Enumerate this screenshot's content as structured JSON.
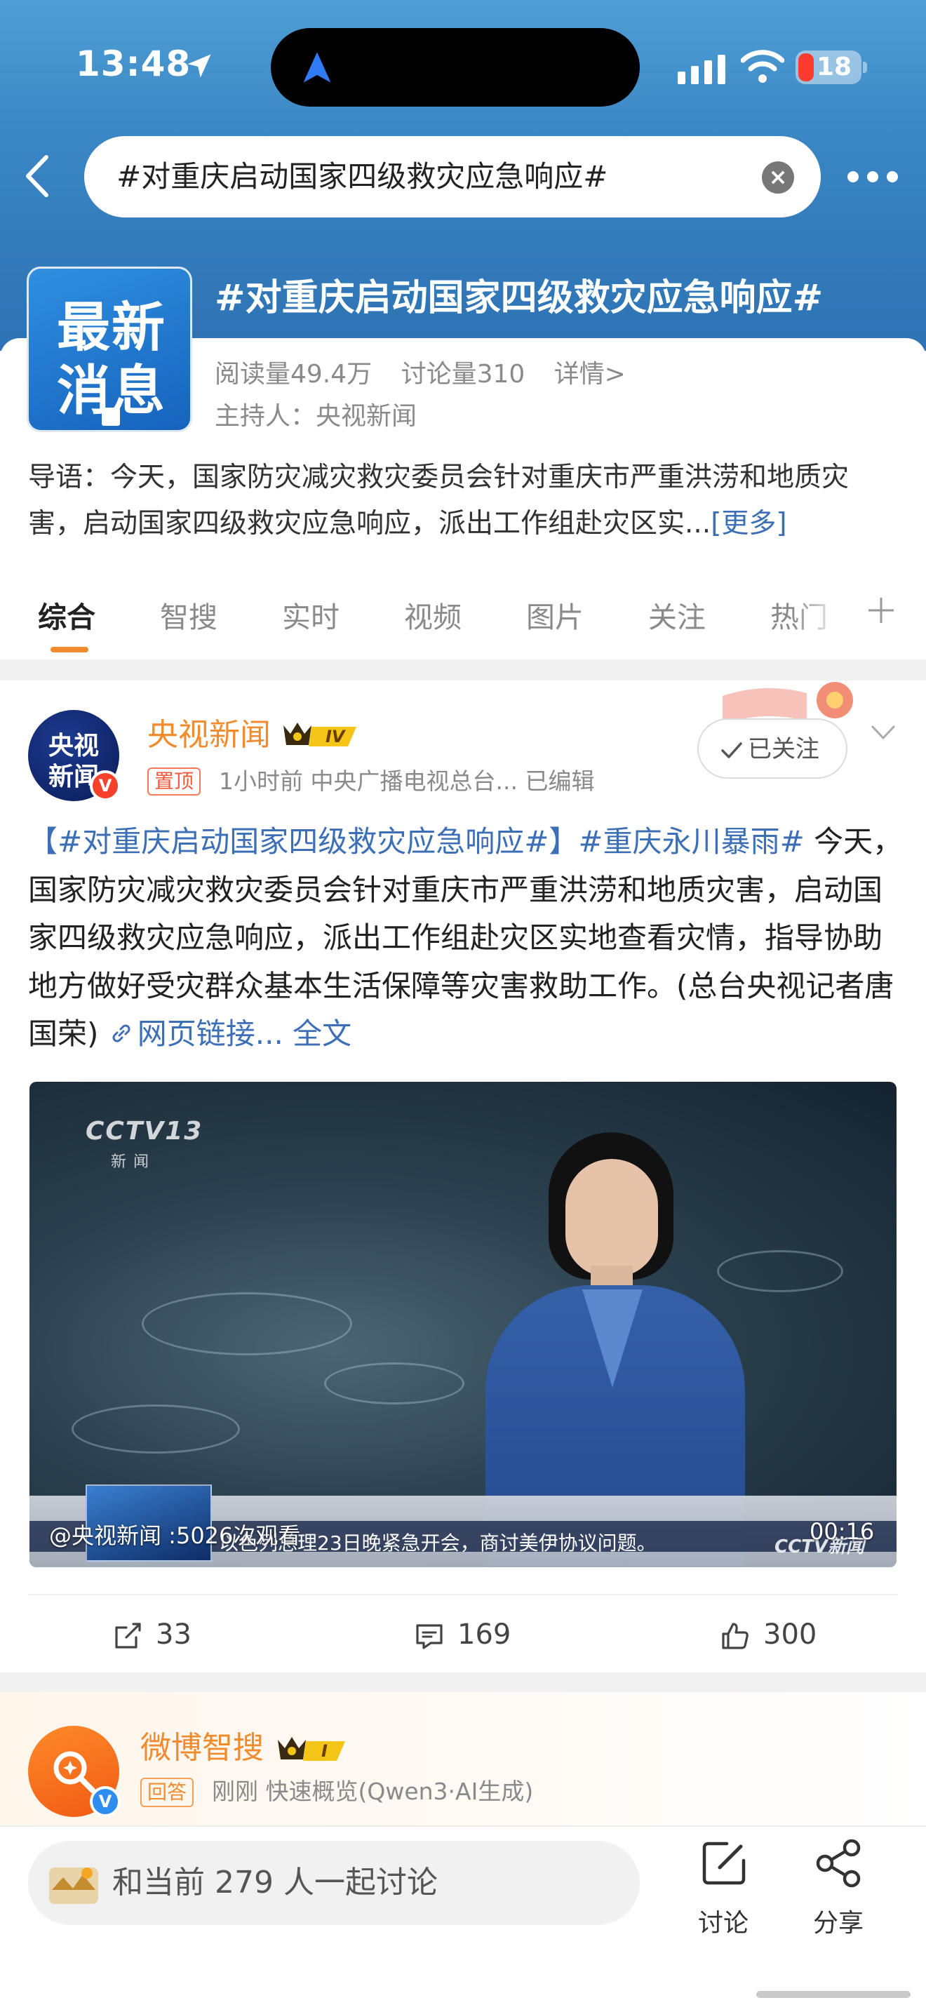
{
  "status_bar": {
    "time": "13:48",
    "battery": "18"
  },
  "search": {
    "query": "#对重庆启动国家四级救灾应急响应#"
  },
  "topic": {
    "thumb_line1": "最新",
    "thumb_line2": "消息",
    "title": "#对重庆启动国家四级救灾应急响应#",
    "reads": "阅读量49.4万",
    "discussions": "讨论量310",
    "details": "详情>",
    "host": "主持人：央视新闻",
    "intro": "导语：今天，国家防灾减灾救灾委员会针对重庆市严重洪涝和地质灾害，启动国家四级救灾应急响应，派出工作组赴灾区实...",
    "intro_more": "[更多]"
  },
  "tabs": [
    "综合",
    "智搜",
    "实时",
    "视频",
    "图片",
    "关注",
    "热门"
  ],
  "post": {
    "avatar_line1": "央视",
    "avatar_line2": "新闻",
    "author": "央视新闻",
    "level": "IV",
    "pinned": "置顶",
    "meta": "1小时前  中央广播电视总台...  已编辑",
    "follow_label": "已关注",
    "tag1": "【#对重庆启动国家四级救灾应急响应#】",
    "tag2": "#重庆永川暴雨#",
    "body": " 今天，国家防灾减灾救灾委员会针对重庆市严重洪涝和地质灾害，启动国家四级救灾应急响应，派出工作组赴灾区实地查看灾情，指导协助地方做好受灾群众基本生活保障等灾害救助工作。(总台央视记者唐国荣) ",
    "link": "网页链接...",
    "full_text": " 全文",
    "video": {
      "channel": "CCTV13",
      "channel_sub": "新闻",
      "views": "@央视新闻 :5026次观看",
      "duration": "00:16",
      "ticker": "以色列总理23日晚紧急开会，商讨美伊协议问题。",
      "brand": "CCTV新闻"
    },
    "reposts": "33",
    "comments": "169",
    "likes": "300"
  },
  "post2": {
    "author": "微博智搜",
    "level": "I",
    "tag": "回答",
    "meta": "刚刚  快速概览(Qwen3·AI生成)"
  },
  "bottom_bar": {
    "discuss_prompt": "和当前 279 人一起讨论",
    "discuss_label": "讨论",
    "share_label": "分享"
  },
  "colors": {
    "accent": "#f08c2e",
    "link": "#3c6fb6",
    "header": "#3a86c4"
  }
}
